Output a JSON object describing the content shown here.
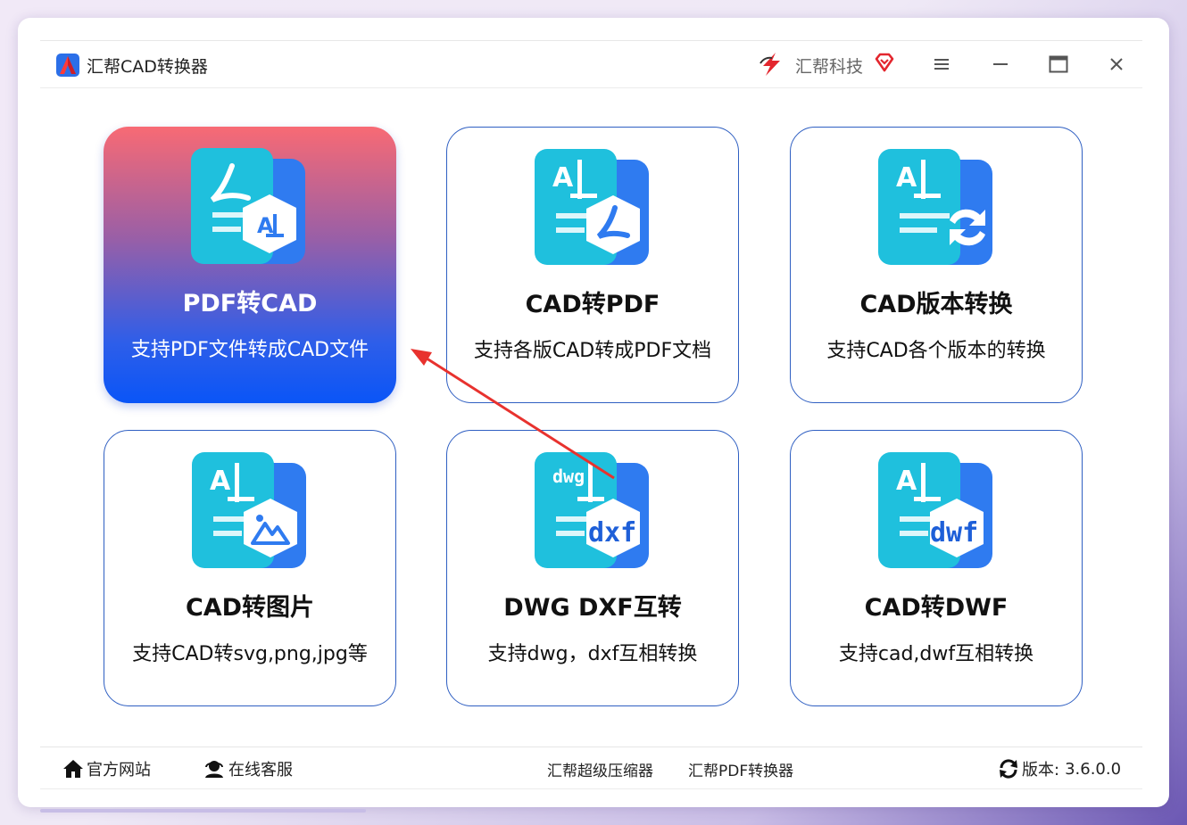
{
  "app": {
    "title": "汇帮CAD转换器"
  },
  "header": {
    "brand_name": "汇帮科技"
  },
  "cards": [
    {
      "title": "PDF转CAD",
      "desc": "支持PDF文件转成CAD文件",
      "icon": "pdf-to-cad-icon",
      "active": true
    },
    {
      "title": "CAD转PDF",
      "desc": "支持各版CAD转成PDF文档",
      "icon": "cad-to-pdf-icon",
      "active": false
    },
    {
      "title": "CAD版本转换",
      "desc": "支持CAD各个版本的转换",
      "icon": "cad-version-convert-icon",
      "active": false
    },
    {
      "title": "CAD转图片",
      "desc": "支持CAD转svg,png,jpg等",
      "icon": "cad-to-image-icon",
      "active": false
    },
    {
      "title": "DWG DXF互转",
      "desc": "支持dwg，dxf互相转换",
      "icon": "dwg-dxf-convert-icon",
      "active": false
    },
    {
      "title": "CAD转DWF",
      "desc": "支持cad,dwf互相转换",
      "icon": "cad-to-dwf-icon",
      "active": false
    }
  ],
  "badges": {
    "dwg": "dwg",
    "dxf": "dxf",
    "dwf": "dwf"
  },
  "footer": {
    "home": "官方网站",
    "service": "在线客服",
    "compressor": "汇帮超级压缩器",
    "pdf_converter": "汇帮PDF转换器",
    "version_label": "版本:",
    "version_value": "3.6.0.0"
  },
  "colors": {
    "active_gradient_top": "#f86a74",
    "active_gradient_bottom": "#0a55f7",
    "card_border": "#2f5fc2",
    "icon_cyan": "#1fc0dd",
    "icon_blue": "#2f7bf0",
    "annotation_arrow": "#e8322e"
  }
}
